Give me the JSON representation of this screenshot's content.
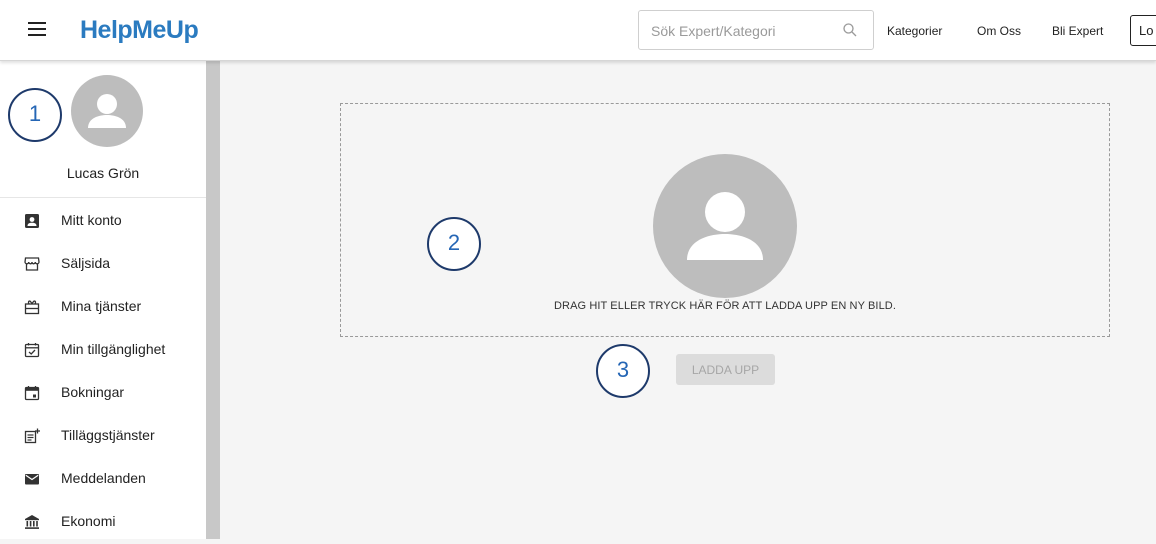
{
  "header": {
    "logo": "HelpMeUp",
    "search_placeholder": "Sök Expert/Kategori",
    "nav": [
      "Kategorier",
      "Om Oss",
      "Bli Expert"
    ],
    "login_label": "Lo"
  },
  "sidebar": {
    "user_name": "Lucas Grön",
    "items": [
      {
        "label": "Mitt konto",
        "icon": "account-box-icon"
      },
      {
        "label": "Säljsida",
        "icon": "storefront-icon"
      },
      {
        "label": "Mina tjänster",
        "icon": "services-icon"
      },
      {
        "label": "Min tillgänglighet",
        "icon": "calendar-check-icon"
      },
      {
        "label": "Bokningar",
        "icon": "calendar-icon"
      },
      {
        "label": "Tilläggstjänster",
        "icon": "add-list-icon"
      },
      {
        "label": "Meddelanden",
        "icon": "mail-icon"
      },
      {
        "label": "Ekonomi",
        "icon": "bank-icon"
      }
    ]
  },
  "main": {
    "dropzone_text": "DRAG HIT ELLER TRYCK HÄR FÖR ATT LADDA UPP EN NY BILD.",
    "upload_label": "LADDA UPP"
  },
  "callouts": [
    "1",
    "2",
    "3"
  ],
  "colors": {
    "brand": "#2b7bc0",
    "callout_border": "#1e3a6b",
    "callout_text": "#2566b5",
    "avatar": "#bdbdbd"
  }
}
